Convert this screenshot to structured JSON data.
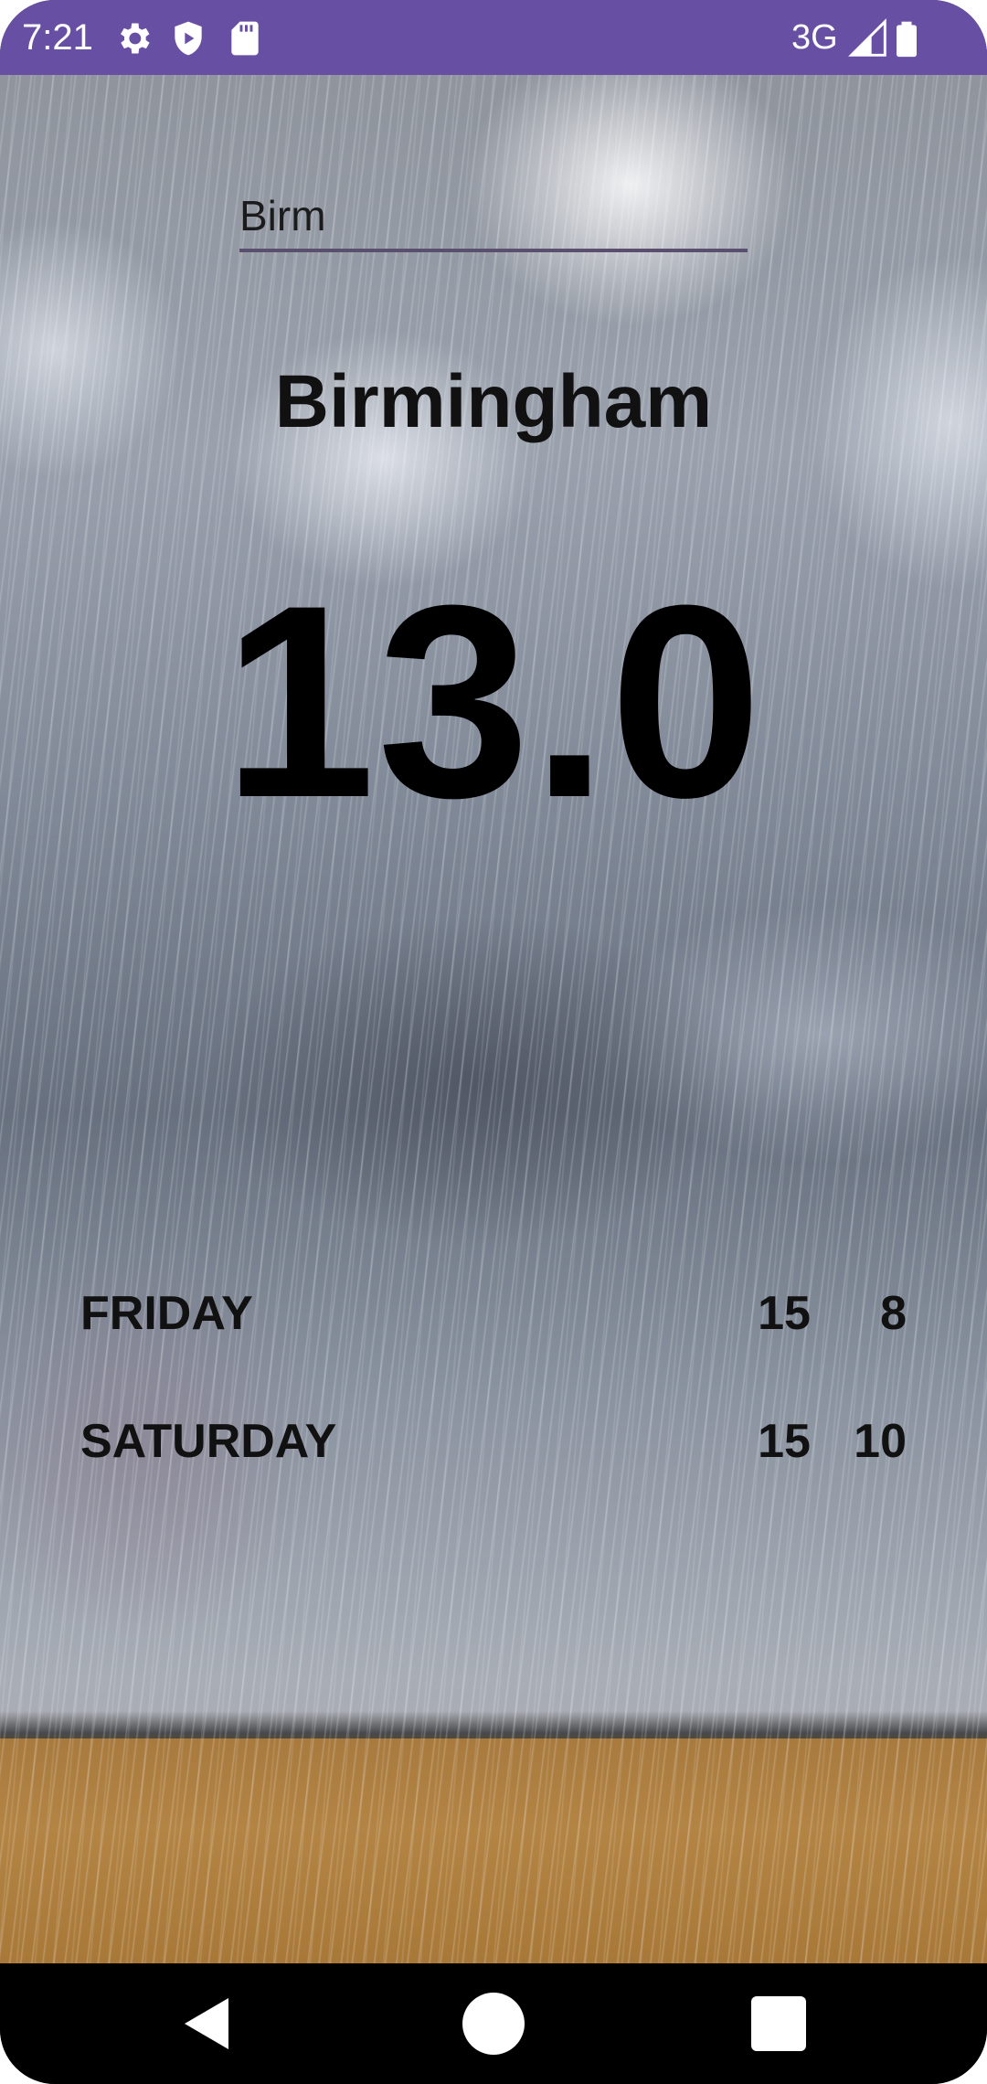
{
  "status_bar": {
    "time": "7:21",
    "network": "3G",
    "icons": [
      "gear-icon",
      "shield-icon",
      "sd-card-icon",
      "signal-icon",
      "battery-icon"
    ],
    "background_color": "#6750a4"
  },
  "search": {
    "value": "Birm"
  },
  "weather": {
    "city": "Birmingham",
    "temperature": "13.0"
  },
  "forecast": [
    {
      "day": "FRIDAY",
      "high": "15",
      "low": "8"
    },
    {
      "day": "SATURDAY",
      "high": "15",
      "low": "10"
    }
  ],
  "nav_bar": {
    "icons": [
      "back-icon",
      "home-icon",
      "recents-icon"
    ]
  }
}
